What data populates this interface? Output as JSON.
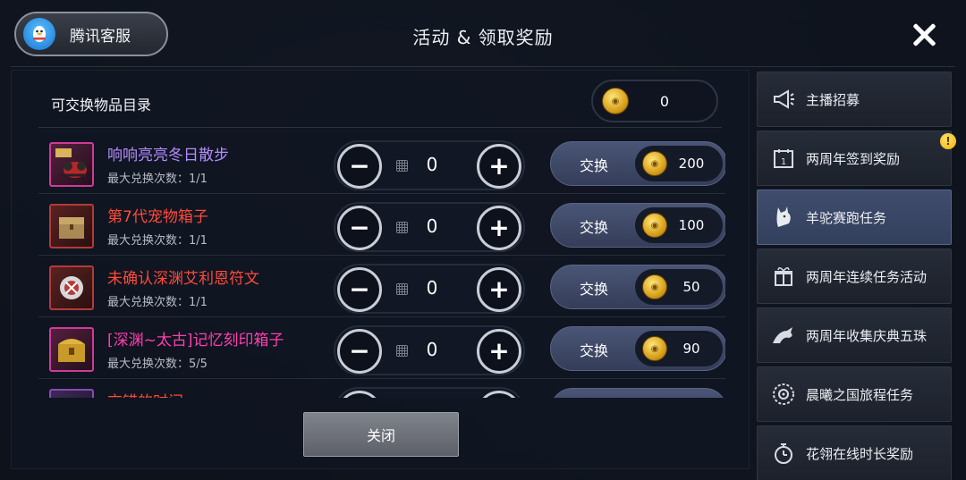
{
  "header": {
    "service_label": "腾讯客服",
    "title": "活动 & 领取奖励"
  },
  "catalog": {
    "title": "可交换物品目录",
    "balance": "0"
  },
  "items": [
    {
      "name": "响响亮亮冬日散步",
      "limit": "最大兑换次数：1/1",
      "qty": "0",
      "exchange_label": "交换",
      "price": "200",
      "name_color": "#b48cff"
    },
    {
      "name": "第7代宠物箱子",
      "limit": "最大兑换次数：1/1",
      "qty": "0",
      "exchange_label": "交换",
      "price": "100",
      "name_color": "#ff4a3a"
    },
    {
      "name": "未确认深渊艾利恩符文",
      "limit": "最大兑换次数：1/1",
      "qty": "0",
      "exchange_label": "交换",
      "price": "50",
      "name_color": "#ff4a3a"
    },
    {
      "name": "[深渊~太古]记忆刻印箱子",
      "limit": "最大兑换次数：5/5",
      "qty": "0",
      "exchange_label": "交换",
      "price": "90",
      "name_color": "#ff3fae"
    },
    {
      "name": "交错的时间",
      "limit": "",
      "qty": "",
      "exchange_label": "",
      "price": "",
      "name_color": "#ff4a3a"
    }
  ],
  "footer": {
    "close_label": "关闭"
  },
  "sidebar": {
    "items": [
      {
        "label": "主播招募",
        "icon": "megaphone-icon"
      },
      {
        "label": "两周年签到奖励",
        "icon": "calendar-icon",
        "badge": "!"
      },
      {
        "label": "羊驼赛跑任务",
        "icon": "alpaca-icon",
        "active": true
      },
      {
        "label": "两周年连续任务活动",
        "icon": "gift-icon"
      },
      {
        "label": "两周年收集庆典五珠",
        "icon": "dragon-icon"
      },
      {
        "label": "晨曦之国旅程任务",
        "icon": "compass-icon"
      },
      {
        "label": "花翎在线时长奖励",
        "icon": "stopwatch-icon"
      }
    ]
  },
  "colors": {
    "active_tab": "#3f4c6d",
    "coin": "#d49b15",
    "exchange_button": "#4a5576"
  }
}
